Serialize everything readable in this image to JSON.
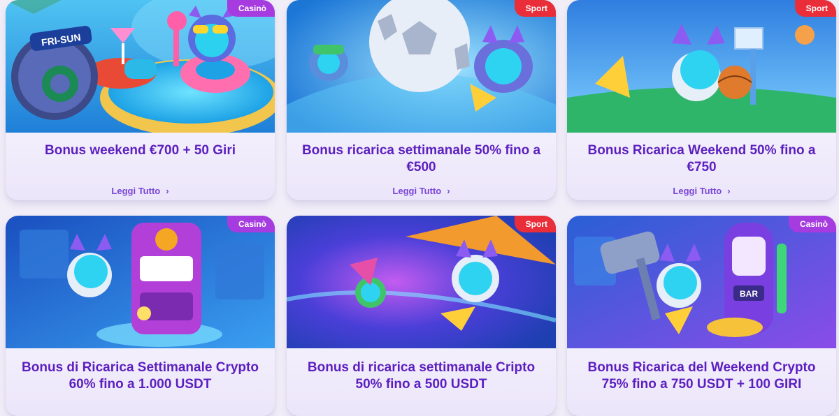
{
  "cards": [
    {
      "badge": "Casinò",
      "title": "Bonus weekend €700 + 50 Giri",
      "link": "Leggi Tutto",
      "art_text": "FRI-SUN"
    },
    {
      "badge": "Sport",
      "title": "Bonus ricarica settimanale 50% fino a €500",
      "link": "Leggi Tutto"
    },
    {
      "badge": "Sport",
      "title": "Bonus Ricarica Weekend 50% fino a €750",
      "link": "Leggi Tutto"
    },
    {
      "badge": "Casinò",
      "title": "Bonus di Ricarica Settimanale Crypto 60% fino a 1.000 USDT"
    },
    {
      "badge": "Sport",
      "title": "Bonus di ricarica settimanale Cripto 50% fino a 500 USDT"
    },
    {
      "badge": "Casinò",
      "title": "Bonus Ricarica del Weekend Crypto 75% fino a 750 USDT + 100 GIRI",
      "art_text": "BAR"
    }
  ],
  "colors": {
    "casino_badge": "#a63ce0",
    "sport_badge": "#e92e3a",
    "title": "#5c1fbf",
    "link": "#7a45d6"
  }
}
